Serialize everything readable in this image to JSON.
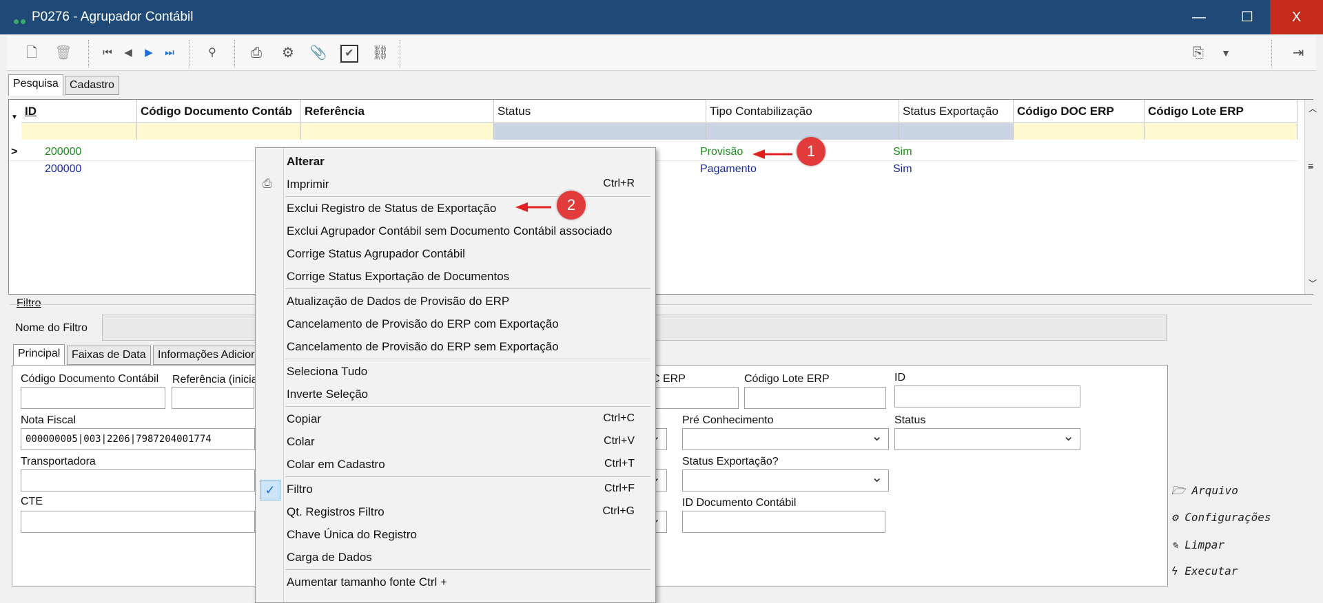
{
  "window": {
    "title": "P0276 - Agrupador Contábil",
    "minimize": "—",
    "maximize": "☐",
    "close": "X"
  },
  "tabs": [
    "Pesquisa",
    "Cadastro"
  ],
  "grid": {
    "headers": [
      "ID",
      "Código Documento Contáb",
      "Referência",
      "Status",
      "Tipo Contabilização",
      "Status Exportação",
      "Código DOC ERP",
      "Código Lote ERP"
    ],
    "rows": [
      {
        "id": "200000",
        "tipo": "Provisão",
        "status_exp": "Sim",
        "color": "#1a8a1a"
      },
      {
        "id": "200000",
        "tipo": "Pagamento",
        "status_exp": "Sim",
        "color": "#1a2a9a"
      }
    ]
  },
  "filter": {
    "title": "Filtro",
    "name_label": "Nome do Filtro",
    "tabs": [
      "Principal",
      "Faixas de Data",
      "Informações Adicior"
    ],
    "labels": {
      "cod_doc": "Código Documento Contábil",
      "referencia": "Referência (inicia",
      "nota_fiscal": "Nota Fiscal",
      "transportadora": "Transportadora",
      "cte": "CTE",
      "c_erp": "C ERP",
      "cod_lote": "Código Lote ERP",
      "id": "ID",
      "pre_conhecimento": "Pré Conhecimento",
      "status": "Status",
      "status_exportacao": "Status Exportação?",
      "id_doc": "ID Documento Contábil"
    },
    "nota_fiscal_value": "000000005|003|2206|7987204001774"
  },
  "actions": {
    "arquivo": "Arquivo",
    "configuracoes": "Configurações",
    "limpar": "Limpar",
    "executar": "Executar"
  },
  "menu": {
    "items": [
      {
        "label": "Alterar",
        "shortcut": ""
      },
      {
        "label": "Imprimir",
        "shortcut": "Ctrl+R"
      },
      {
        "label": "Exclui Registro de Status de Exportação",
        "shortcut": ""
      },
      {
        "label": "Exclui Agrupador Contábil sem Documento Contábil associado",
        "shortcut": ""
      },
      {
        "label": "Corrige Status Agrupador Contábil",
        "shortcut": ""
      },
      {
        "label": "Corrige Status Exportação de Documentos",
        "shortcut": ""
      },
      {
        "label": "Atualização de Dados de Provisão do ERP",
        "shortcut": ""
      },
      {
        "label": "Cancelamento de Provisão do ERP com Exportação",
        "shortcut": ""
      },
      {
        "label": "Cancelamento de Provisão do ERP sem Exportação",
        "shortcut": ""
      },
      {
        "label": "Seleciona Tudo",
        "shortcut": ""
      },
      {
        "label": "Inverte Seleção",
        "shortcut": ""
      },
      {
        "label": "Copiar",
        "shortcut": "Ctrl+C"
      },
      {
        "label": "Colar",
        "shortcut": "Ctrl+V"
      },
      {
        "label": "Colar em Cadastro",
        "shortcut": "Ctrl+T"
      },
      {
        "label": "Filtro",
        "shortcut": "Ctrl+F"
      },
      {
        "label": "Qt. Registros Filtro",
        "shortcut": "Ctrl+G"
      },
      {
        "label": "Chave Única do Registro",
        "shortcut": ""
      },
      {
        "label": "Carga de Dados",
        "shortcut": ""
      },
      {
        "label": "Aumentar tamanho fonte  Ctrl +",
        "shortcut": ""
      }
    ]
  },
  "badges": [
    "1",
    "2"
  ]
}
